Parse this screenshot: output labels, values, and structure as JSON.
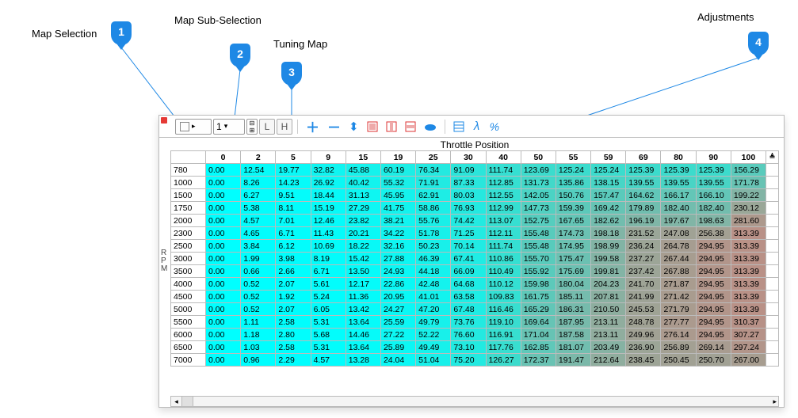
{
  "annotations": {
    "a1": "Map Selection",
    "a2": "Map Sub-Selection",
    "a3": "Tuning Map",
    "a4": "Adjustments",
    "n1": "1",
    "n2": "2",
    "n3": "3",
    "n4": "4"
  },
  "toolbar": {
    "map_select_value": "",
    "sub_select_value": "1",
    "box_L": "L",
    "box_H": "H",
    "lambda": "λ",
    "percent": "%"
  },
  "axis_title": "Throttle Position",
  "rpm_axis": "R\nP\nM",
  "col_headers": [
    "0",
    "2",
    "5",
    "9",
    "15",
    "19",
    "25",
    "30",
    "40",
    "50",
    "55",
    "59",
    "69",
    "80",
    "90",
    "100"
  ],
  "rows": [
    {
      "rpm": "780",
      "v": [
        "0.00",
        "12.54",
        "19.77",
        "32.82",
        "45.88",
        "60.19",
        "76.34",
        "91.09",
        "111.74",
        "123.69",
        "125.24",
        "125.24",
        "125.39",
        "125.39",
        "125.39",
        "156.29"
      ]
    },
    {
      "rpm": "1000",
      "v": [
        "0.00",
        "8.26",
        "14.23",
        "26.92",
        "40.42",
        "55.32",
        "71.91",
        "87.33",
        "112.85",
        "131.73",
        "135.86",
        "138.15",
        "139.55",
        "139.55",
        "139.55",
        "171.78"
      ]
    },
    {
      "rpm": "1500",
      "v": [
        "0.00",
        "6.27",
        "9.51",
        "18.44",
        "31.13",
        "45.95",
        "62.91",
        "80.03",
        "112.55",
        "142.05",
        "150.76",
        "157.47",
        "164.62",
        "166.17",
        "166.10",
        "199.22"
      ]
    },
    {
      "rpm": "1750",
      "v": [
        "0.00",
        "5.38",
        "8.11",
        "15.19",
        "27.29",
        "41.75",
        "58.86",
        "76.93",
        "112.99",
        "147.73",
        "159.39",
        "169.42",
        "179.89",
        "182.40",
        "182.40",
        "230.12"
      ]
    },
    {
      "rpm": "2000",
      "v": [
        "0.00",
        "4.57",
        "7.01",
        "12.46",
        "23.82",
        "38.21",
        "55.76",
        "74.42",
        "113.07",
        "152.75",
        "167.65",
        "182.62",
        "196.19",
        "197.67",
        "198.63",
        "281.60"
      ]
    },
    {
      "rpm": "2300",
      "v": [
        "0.00",
        "4.65",
        "6.71",
        "11.43",
        "20.21",
        "34.22",
        "51.78",
        "71.25",
        "112.11",
        "155.48",
        "174.73",
        "198.18",
        "231.52",
        "247.08",
        "256.38",
        "313.39"
      ]
    },
    {
      "rpm": "2500",
      "v": [
        "0.00",
        "3.84",
        "6.12",
        "10.69",
        "18.22",
        "32.16",
        "50.23",
        "70.14",
        "111.74",
        "155.48",
        "174.95",
        "198.99",
        "236.24",
        "264.78",
        "294.95",
        "313.39"
      ]
    },
    {
      "rpm": "3000",
      "v": [
        "0.00",
        "1.99",
        "3.98",
        "8.19",
        "15.42",
        "27.88",
        "46.39",
        "67.41",
        "110.86",
        "155.70",
        "175.47",
        "199.58",
        "237.27",
        "267.44",
        "294.95",
        "313.39"
      ]
    },
    {
      "rpm": "3500",
      "v": [
        "0.00",
        "0.66",
        "2.66",
        "6.71",
        "13.50",
        "24.93",
        "44.18",
        "66.09",
        "110.49",
        "155.92",
        "175.69",
        "199.81",
        "237.42",
        "267.88",
        "294.95",
        "313.39"
      ]
    },
    {
      "rpm": "4000",
      "v": [
        "0.00",
        "0.52",
        "2.07",
        "5.61",
        "12.17",
        "22.86",
        "42.48",
        "64.68",
        "110.12",
        "159.98",
        "180.04",
        "204.23",
        "241.70",
        "271.87",
        "294.95",
        "313.39"
      ]
    },
    {
      "rpm": "4500",
      "v": [
        "0.00",
        "0.52",
        "1.92",
        "5.24",
        "11.36",
        "20.95",
        "41.01",
        "63.58",
        "109.83",
        "161.75",
        "185.11",
        "207.81",
        "241.99",
        "271.42",
        "294.95",
        "313.39"
      ]
    },
    {
      "rpm": "5000",
      "v": [
        "0.00",
        "0.52",
        "2.07",
        "6.05",
        "13.42",
        "24.27",
        "47.20",
        "67.48",
        "116.46",
        "165.29",
        "186.31",
        "210.50",
        "245.53",
        "271.79",
        "294.95",
        "313.39"
      ]
    },
    {
      "rpm": "5500",
      "v": [
        "0.00",
        "1.11",
        "2.58",
        "5.31",
        "13.64",
        "25.59",
        "49.79",
        "73.76",
        "119.10",
        "169.64",
        "187.95",
        "213.11",
        "248.78",
        "277.77",
        "294.95",
        "310.37"
      ]
    },
    {
      "rpm": "6000",
      "v": [
        "0.00",
        "1.18",
        "2.80",
        "5.68",
        "14.46",
        "27.22",
        "52.22",
        "76.60",
        "116.91",
        "171.04",
        "187.58",
        "213.11",
        "249.96",
        "276.14",
        "294.95",
        "307.27"
      ]
    },
    {
      "rpm": "6500",
      "v": [
        "0.00",
        "1.03",
        "2.58",
        "5.31",
        "13.64",
        "25.89",
        "49.49",
        "73.10",
        "117.76",
        "162.85",
        "181.07",
        "203.49",
        "236.90",
        "256.89",
        "269.14",
        "297.24"
      ]
    },
    {
      "rpm": "7000",
      "v": [
        "0.00",
        "0.96",
        "2.29",
        "4.57",
        "13.28",
        "24.04",
        "51.04",
        "75.20",
        "126.27",
        "172.37",
        "191.47",
        "212.64",
        "238.45",
        "250.45",
        "250.70",
        "267.00"
      ]
    }
  ],
  "chart_data": {
    "type": "table",
    "title": "Throttle Position vs RPM tuning map",
    "xlabel": "Throttle Position",
    "ylabel": "RPM",
    "x": [
      0,
      2,
      5,
      9,
      15,
      19,
      25,
      30,
      40,
      50,
      55,
      59,
      69,
      80,
      90,
      100
    ],
    "y": [
      780,
      1000,
      1500,
      1750,
      2000,
      2300,
      2500,
      3000,
      3500,
      4000,
      4500,
      5000,
      5500,
      6000,
      6500,
      7000
    ],
    "values": [
      [
        0.0,
        12.54,
        19.77,
        32.82,
        45.88,
        60.19,
        76.34,
        91.09,
        111.74,
        123.69,
        125.24,
        125.24,
        125.39,
        125.39,
        125.39,
        156.29
      ],
      [
        0.0,
        8.26,
        14.23,
        26.92,
        40.42,
        55.32,
        71.91,
        87.33,
        112.85,
        131.73,
        135.86,
        138.15,
        139.55,
        139.55,
        139.55,
        171.78
      ],
      [
        0.0,
        6.27,
        9.51,
        18.44,
        31.13,
        45.95,
        62.91,
        80.03,
        112.55,
        142.05,
        150.76,
        157.47,
        164.62,
        166.17,
        166.1,
        199.22
      ],
      [
        0.0,
        5.38,
        8.11,
        15.19,
        27.29,
        41.75,
        58.86,
        76.93,
        112.99,
        147.73,
        159.39,
        169.42,
        179.89,
        182.4,
        182.4,
        230.12
      ],
      [
        0.0,
        4.57,
        7.01,
        12.46,
        23.82,
        38.21,
        55.76,
        74.42,
        113.07,
        152.75,
        167.65,
        182.62,
        196.19,
        197.67,
        198.63,
        281.6
      ],
      [
        0.0,
        4.65,
        6.71,
        11.43,
        20.21,
        34.22,
        51.78,
        71.25,
        112.11,
        155.48,
        174.73,
        198.18,
        231.52,
        247.08,
        256.38,
        313.39
      ],
      [
        0.0,
        3.84,
        6.12,
        10.69,
        18.22,
        32.16,
        50.23,
        70.14,
        111.74,
        155.48,
        174.95,
        198.99,
        236.24,
        264.78,
        294.95,
        313.39
      ],
      [
        0.0,
        1.99,
        3.98,
        8.19,
        15.42,
        27.88,
        46.39,
        67.41,
        110.86,
        155.7,
        175.47,
        199.58,
        237.27,
        267.44,
        294.95,
        313.39
      ],
      [
        0.0,
        0.66,
        2.66,
        6.71,
        13.5,
        24.93,
        44.18,
        66.09,
        110.49,
        155.92,
        175.69,
        199.81,
        237.42,
        267.88,
        294.95,
        313.39
      ],
      [
        0.0,
        0.52,
        2.07,
        5.61,
        12.17,
        22.86,
        42.48,
        64.68,
        110.12,
        159.98,
        180.04,
        204.23,
        241.7,
        271.87,
        294.95,
        313.39
      ],
      [
        0.0,
        0.52,
        1.92,
        5.24,
        11.36,
        20.95,
        41.01,
        63.58,
        109.83,
        161.75,
        185.11,
        207.81,
        241.99,
        271.42,
        294.95,
        313.39
      ],
      [
        0.0,
        0.52,
        2.07,
        6.05,
        13.42,
        24.27,
        47.2,
        67.48,
        116.46,
        165.29,
        186.31,
        210.5,
        245.53,
        271.79,
        294.95,
        313.39
      ],
      [
        0.0,
        1.11,
        2.58,
        5.31,
        13.64,
        25.59,
        49.79,
        73.76,
        119.1,
        169.64,
        187.95,
        213.11,
        248.78,
        277.77,
        294.95,
        310.37
      ],
      [
        0.0,
        1.18,
        2.8,
        5.68,
        14.46,
        27.22,
        52.22,
        76.6,
        116.91,
        171.04,
        187.58,
        213.11,
        249.96,
        276.14,
        294.95,
        307.27
      ],
      [
        0.0,
        1.03,
        2.58,
        5.31,
        13.64,
        25.89,
        49.49,
        73.1,
        117.76,
        162.85,
        181.07,
        203.49,
        236.9,
        256.89,
        269.14,
        297.24
      ],
      [
        0.0,
        0.96,
        2.29,
        4.57,
        13.28,
        24.04,
        51.04,
        75.2,
        126.27,
        172.37,
        191.47,
        212.64,
        238.45,
        250.45,
        250.7,
        267.0
      ]
    ],
    "value_range": [
      0,
      313.39
    ]
  }
}
